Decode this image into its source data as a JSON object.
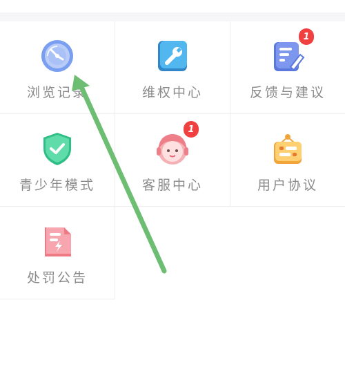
{
  "grid": {
    "row1": [
      {
        "label": "浏览记录",
        "icon": "history-clock-icon"
      },
      {
        "label": "维权中心",
        "icon": "wrench-icon"
      },
      {
        "label": "反馈与建议",
        "icon": "feedback-edit-icon",
        "badge": "1"
      }
    ],
    "row2": [
      {
        "label": "青少年模式",
        "icon": "shield-check-icon"
      },
      {
        "label": "客服中心",
        "icon": "customer-service-icon",
        "badge": "1"
      },
      {
        "label": "用户协议",
        "icon": "agreement-sign-icon"
      }
    ],
    "row3": [
      {
        "label": "处罚公告",
        "icon": "penalty-notice-icon"
      }
    ]
  },
  "colors": {
    "accent_blue": "#7a9ff0",
    "badge_red": "#f04040",
    "arrow_green": "#6dbd72"
  }
}
